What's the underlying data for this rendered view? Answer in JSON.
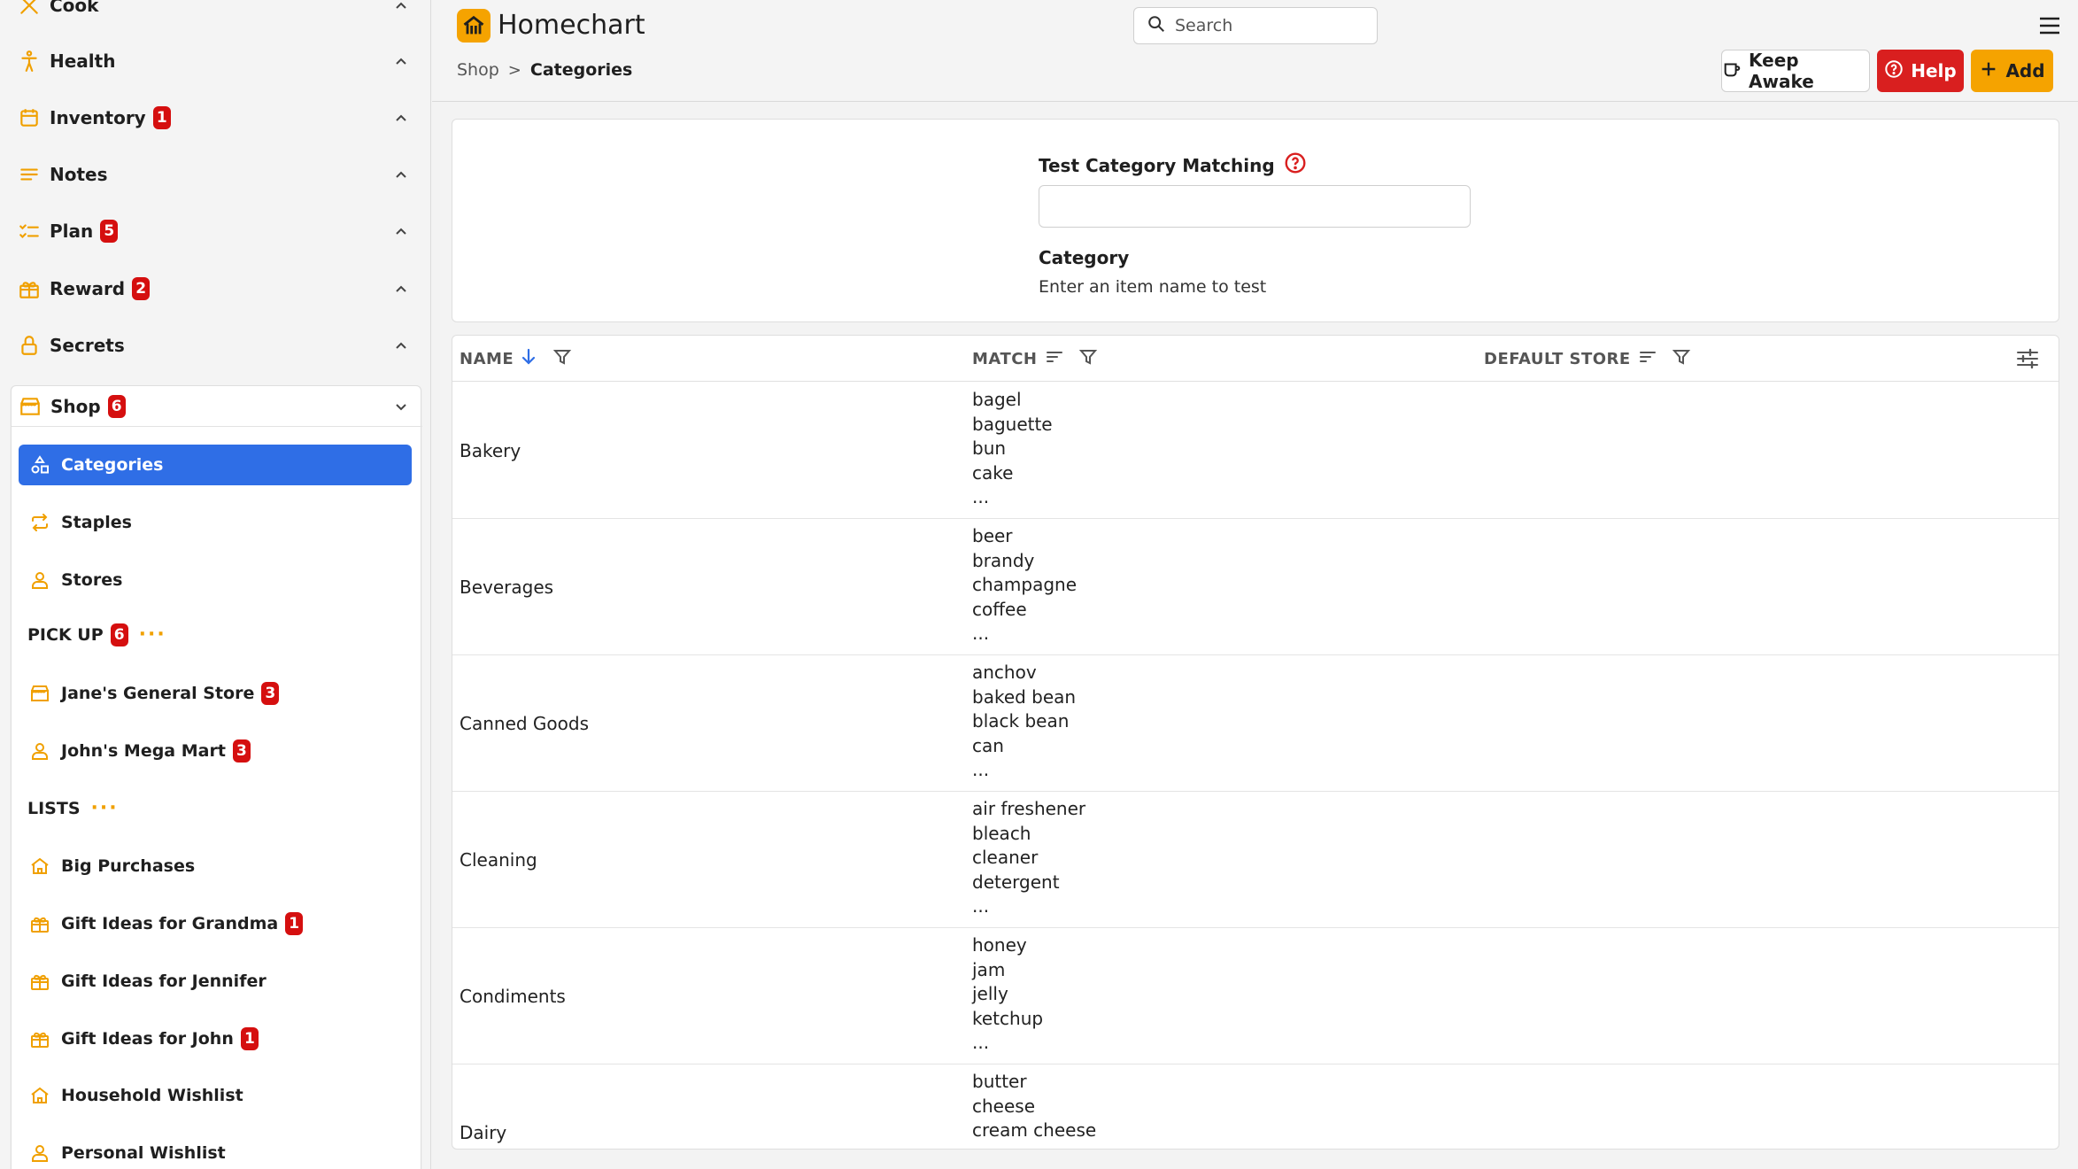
{
  "sidebar": {
    "top_items": [
      {
        "label": "Cook"
      },
      {
        "label": "Health"
      },
      {
        "label": "Inventory",
        "badge": "1"
      },
      {
        "label": "Notes"
      },
      {
        "label": "Plan",
        "badge": "5"
      },
      {
        "label": "Reward",
        "badge": "2"
      },
      {
        "label": "Secrets"
      }
    ],
    "shop": {
      "label": "Shop",
      "badge": "6",
      "items": [
        {
          "label": "Categories"
        },
        {
          "label": "Staples"
        },
        {
          "label": "Stores"
        }
      ],
      "pickup": {
        "title": "PICK UP",
        "badge": "6",
        "more": "···"
      },
      "pickup_items": [
        {
          "label": "Jane's General Store",
          "badge": "3"
        },
        {
          "label": "John's Mega Mart",
          "badge": "3"
        }
      ],
      "lists": {
        "title": "LISTS",
        "more": "···"
      },
      "list_items": [
        {
          "label": "Big Purchases"
        },
        {
          "label": "Gift Ideas for Grandma",
          "badge": "1"
        },
        {
          "label": "Gift Ideas for Jennifer"
        },
        {
          "label": "Gift Ideas for John",
          "badge": "1"
        },
        {
          "label": "Household Wishlist"
        },
        {
          "label": "Personal Wishlist"
        }
      ]
    }
  },
  "header": {
    "app_title": "Homechart",
    "search_placeholder": "Search",
    "breadcrumb": {
      "parent": "Shop",
      "separator": ">",
      "current": "Categories"
    },
    "buttons": {
      "keep_awake": "Keep Awake",
      "help": "Help",
      "add": "Add"
    }
  },
  "test": {
    "label": "Test Category Matching",
    "input_value": "",
    "category_title": "Category",
    "category_value": "Enter an item name to test"
  },
  "table": {
    "columns": {
      "name": "NAME",
      "match": "MATCH",
      "default_store": "DEFAULT STORE"
    },
    "rows": [
      {
        "name": "Bakery",
        "match": [
          "bagel",
          "baguette",
          "bun",
          "cake",
          "..."
        ]
      },
      {
        "name": "Beverages",
        "match": [
          "beer",
          "brandy",
          "champagne",
          "coffee",
          "..."
        ]
      },
      {
        "name": "Canned Goods",
        "match": [
          "anchov",
          "baked bean",
          "black bean",
          "can",
          "..."
        ]
      },
      {
        "name": "Cleaning",
        "match": [
          "air freshener",
          "bleach",
          "cleaner",
          "detergent",
          "..."
        ]
      },
      {
        "name": "Condiments",
        "match": [
          "honey",
          "jam",
          "jelly",
          "ketchup",
          "..."
        ]
      },
      {
        "name": "Dairy",
        "match": [
          "butter",
          "cheese",
          "cream cheese",
          "..."
        ]
      }
    ]
  },
  "colors": {
    "accent": "#f5a300",
    "active": "#2f6ee6",
    "badge": "#d50f0f",
    "help": "#d91f1f"
  }
}
